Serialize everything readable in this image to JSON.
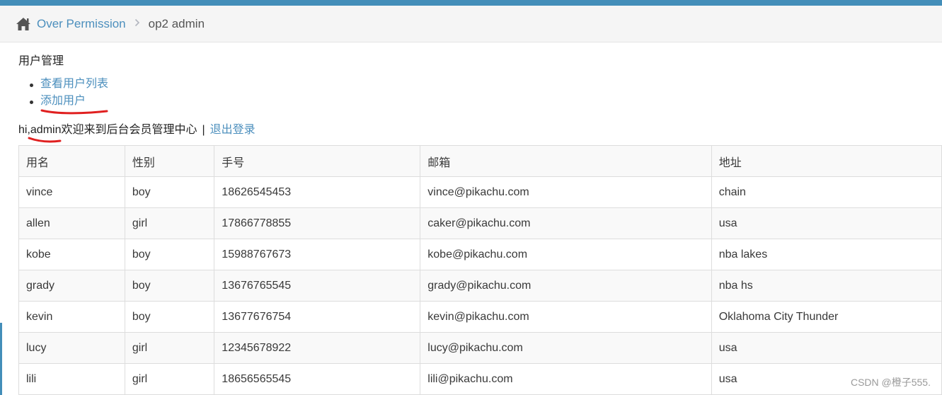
{
  "breadcrumb": {
    "home_icon": "home-icon",
    "parent": "Over Permission",
    "separator": ">",
    "current": "op2 admin"
  },
  "section": {
    "title": "用户管理",
    "links": [
      "查看用户列表",
      "添加用户"
    ]
  },
  "welcome": {
    "text": "hi,admin欢迎来到后台会员管理中心",
    "separator": "|",
    "logout_label": "退出登录"
  },
  "table": {
    "headers": [
      "用名",
      "性别",
      "手号",
      "邮箱",
      "地址"
    ],
    "rows": [
      [
        "vince",
        "boy",
        "18626545453",
        "vince@pikachu.com",
        "chain"
      ],
      [
        "allen",
        "girl",
        "17866778855",
        "caker@pikachu.com",
        "usa"
      ],
      [
        "kobe",
        "boy",
        "15988767673",
        "kobe@pikachu.com",
        "nba lakes"
      ],
      [
        "grady",
        "boy",
        "13676765545",
        "grady@pikachu.com",
        "nba hs"
      ],
      [
        "kevin",
        "boy",
        "13677676754",
        "kevin@pikachu.com",
        "Oklahoma City Thunder"
      ],
      [
        "lucy",
        "girl",
        "12345678922",
        "lucy@pikachu.com",
        "usa"
      ],
      [
        "lili",
        "girl",
        "18656565545",
        "lili@pikachu.com",
        "usa"
      ]
    ]
  },
  "watermark": "CSDN @橙子555.",
  "colors": {
    "accent": "#438eb9",
    "link": "#4c8fbd",
    "annotation": "#e02020"
  }
}
